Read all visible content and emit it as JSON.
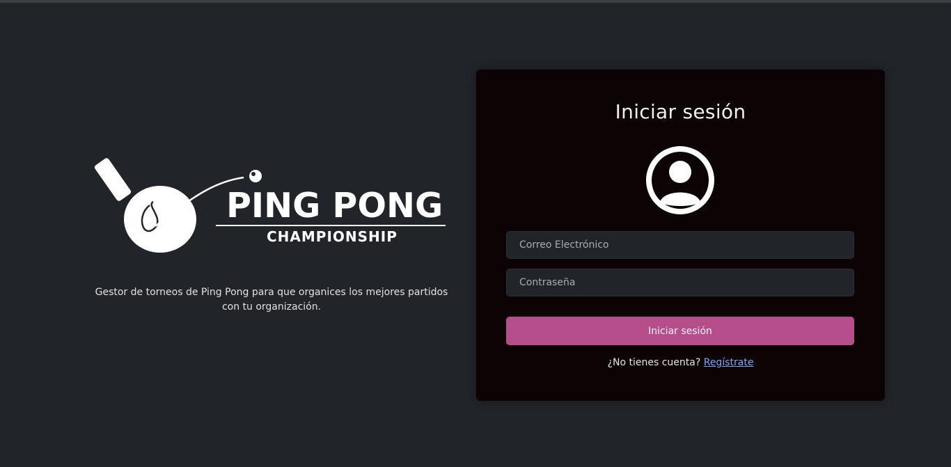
{
  "brand": {
    "title": "PING PONG",
    "subtitle": "CHAMPIONSHIP",
    "tagline": "Gestor de torneos de Ping Pong para que organices los mejores partidos con tu organización."
  },
  "login": {
    "title": "Iniciar sesión",
    "avatar_icon": "user-circle-icon",
    "email_placeholder": "Correo Electrónico",
    "email_value": "",
    "password_placeholder": "Contraseña",
    "password_value": "",
    "submit_label": "Iniciar sesión",
    "register_prompt": "¿No tienes cuenta?",
    "register_link": "Regístrate"
  },
  "colors": {
    "background": "#212429",
    "card": "#0c0305",
    "accent": "#b54e8b",
    "link": "#7aa7ff"
  }
}
